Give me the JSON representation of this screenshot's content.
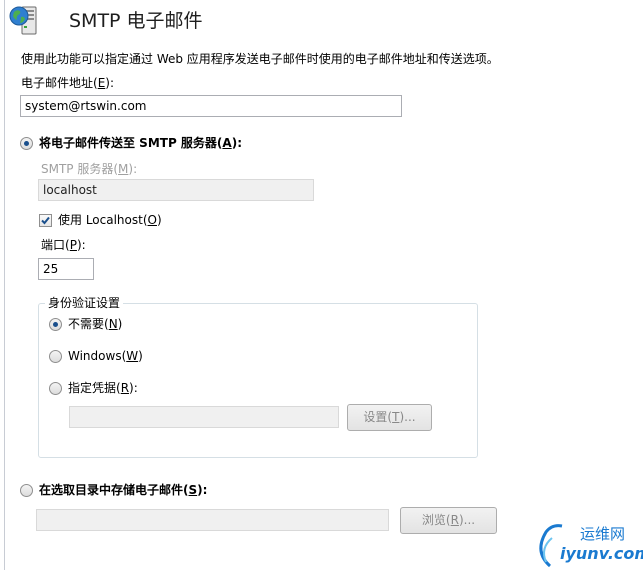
{
  "header": {
    "title": "SMTP 电子邮件",
    "icon": "globe-server-icon"
  },
  "description": "使用此功能可以指定通过 Web 应用程序发送电子邮件时使用的电子邮件地址和传送选项。",
  "email": {
    "label_before": "电子邮件地址(",
    "label_key": "E",
    "label_after": "):",
    "value": "system@rtswin.com"
  },
  "smtp_option": {
    "label_before": "将电子邮件传送至 SMTP 服务器(",
    "label_key": "A",
    "label_after": "):",
    "selected": true
  },
  "smtp_server": {
    "label_before": "SMTP 服务器(",
    "label_key": "M",
    "label_after": "):",
    "value": "localhost"
  },
  "use_localhost": {
    "label_before": "使用 Localhost(",
    "label_key": "O",
    "label_after": ")",
    "checked": true
  },
  "port": {
    "label_before": "端口(",
    "label_key": "P",
    "label_after": "):",
    "value": "25"
  },
  "auth": {
    "legend": "身份验证设置",
    "none": {
      "label_before": "不需要(",
      "label_key": "N",
      "label_after": ")",
      "selected": true
    },
    "windows": {
      "label_before": "Windows(",
      "label_key": "W",
      "label_after": ")",
      "selected": false
    },
    "specify": {
      "label_before": "指定凭据(",
      "label_key": "R",
      "label_after": "):",
      "selected": false
    },
    "credentials_value": "",
    "set_button": {
      "label_before": "设置(",
      "label_key": "T",
      "label_after": ")..."
    }
  },
  "pickup_option": {
    "label_before": "在选取目录中存储电子邮件(",
    "label_key": "S",
    "label_after": "):",
    "selected": false,
    "directory_value": "",
    "browse_button": {
      "label_before": "浏览(",
      "label_key": "R",
      "label_after": ")..."
    }
  },
  "watermark": {
    "brand": "运维网",
    "site": "iyunv.com"
  },
  "colors": {
    "selected_dot": "#1a4f8c",
    "disabled_text": "#a0a0a0",
    "logo_blue": "#1a7ad0"
  }
}
